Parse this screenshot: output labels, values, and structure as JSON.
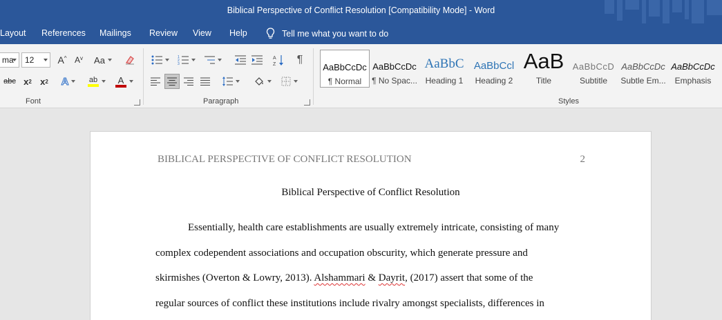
{
  "window": {
    "title": "Biblical Perspective of Conflict Resolution [Compatibility Mode]  -  Word"
  },
  "tabs": [
    {
      "label": "Layout"
    },
    {
      "label": "References"
    },
    {
      "label": "Mailings"
    },
    {
      "label": "Review"
    },
    {
      "label": "View"
    },
    {
      "label": "Help"
    }
  ],
  "tell_me": {
    "label": "Tell me what you want to do",
    "icon": "lightbulb-icon"
  },
  "font_group": {
    "label": "Font",
    "font_name": "ma",
    "font_size": "12",
    "change_case": "Aa",
    "grow_font": "A",
    "shrink_font": "A",
    "strikethrough": "abc",
    "subscript": "x",
    "superscript": "x",
    "text_effects": "A",
    "highlight": "ab",
    "font_color": "A",
    "colors": {
      "highlight": "#ffff00",
      "font_color": "#c00000",
      "clear_format": "#d84a4a"
    }
  },
  "paragraph_group": {
    "label": "Paragraph"
  },
  "styles_group": {
    "label": "Styles",
    "items": [
      {
        "sample": "AaBbCcDc",
        "name": "¶ Normal"
      },
      {
        "sample": "AaBbCcDc",
        "name": "¶ No Spac..."
      },
      {
        "sample": "AaBbC",
        "name": "Heading 1"
      },
      {
        "sample": "AaBbCcl",
        "name": "Heading 2"
      },
      {
        "sample": "AaB",
        "name": "Title"
      },
      {
        "sample": "AaBbCcD",
        "name": "Subtitle"
      },
      {
        "sample": "AaBbCcDc",
        "name": "Subtle Em..."
      },
      {
        "sample": "AaBbCcDc",
        "name": "Emphasis"
      }
    ]
  },
  "document": {
    "running_head": "BIBLICAL PERSPECTIVE OF CONFLICT RESOLUTION",
    "page_number": "2",
    "title": "Biblical Perspective of Conflict Resolution",
    "line1": "Essentially, health care establishments are usually extremely intricate, consisting of many",
    "line2": "complex codependent associations and occupation obscurity, which generate pressure and",
    "line3_a": "skirmishes (Overton & Lowry, 2013). ",
    "line3_err1": "Alshammari",
    "line3_b": " & ",
    "line3_err2": "Dayrit",
    "line3_c": ", (2017) assert that some of the",
    "line4": "regular sources of conflict these institutions include rivalry amongst specialists, differences in"
  }
}
